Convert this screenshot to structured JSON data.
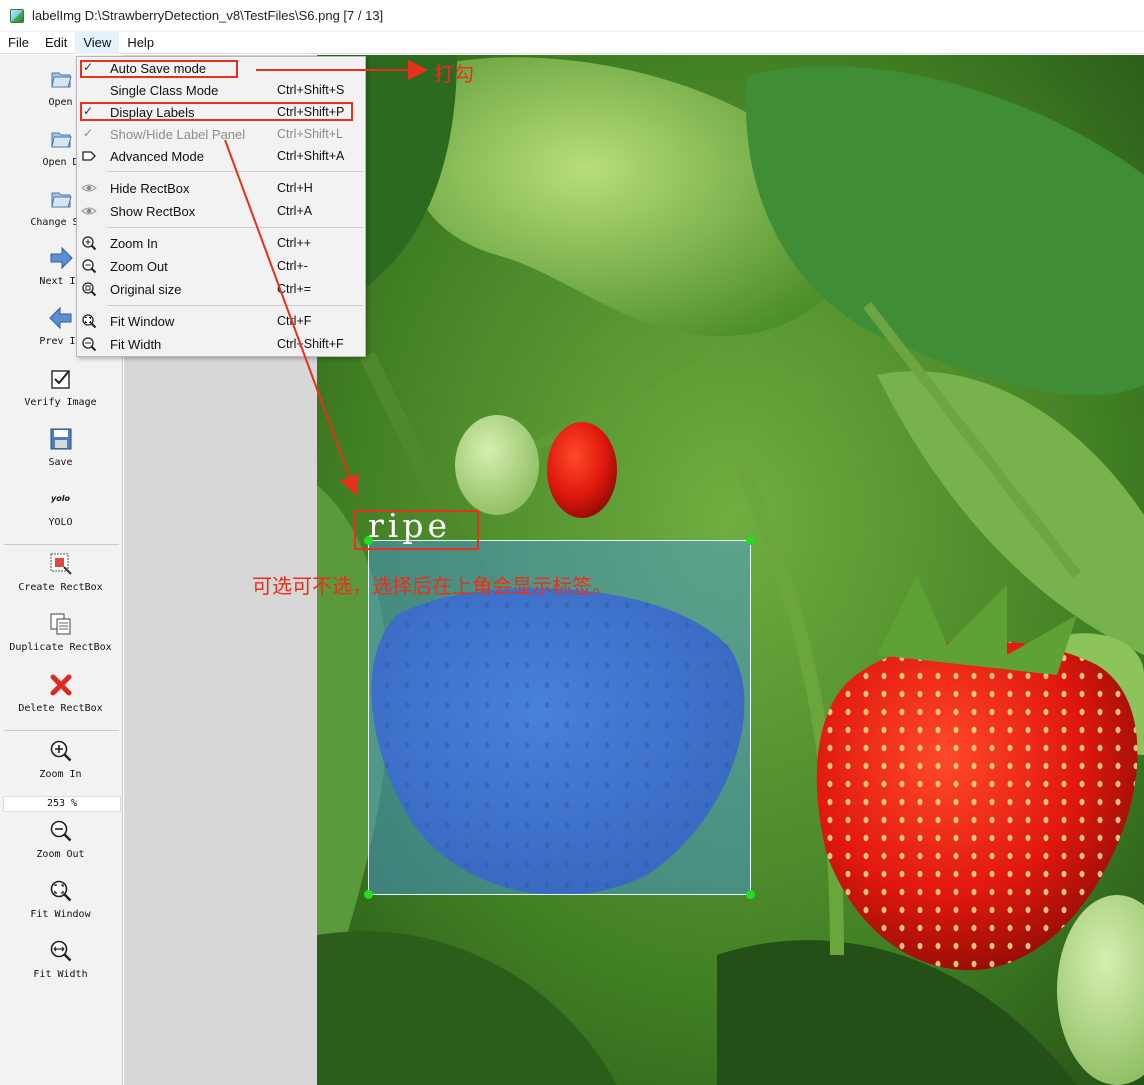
{
  "window": {
    "title": "labelImg D:\\StrawberryDetection_v8\\TestFiles\\S6.png [7 / 13]"
  },
  "menubar": {
    "items": [
      "File",
      "Edit",
      "View",
      "Help"
    ]
  },
  "toolbar": {
    "open": "Open",
    "open_dir": "Open D",
    "change_save": "Change Sav",
    "next_image": "Next Im",
    "prev_image": "Prev Im",
    "verify_image": "Verify Image",
    "save": "Save",
    "yolo_icon_text": "yolo",
    "yolo": "YOLO",
    "create_rectbox": "Create RectBox",
    "duplicate_rectbox": "Duplicate RectBox",
    "delete_rectbox": "Delete RectBox",
    "zoom_in": "Zoom In",
    "zoom_value": "253 %",
    "zoom_out": "Zoom Out",
    "fit_window": "Fit Window",
    "fit_width": "Fit Width"
  },
  "view_menu": {
    "items": [
      {
        "label": "Auto Save mode",
        "shortcut": "",
        "checked": true
      },
      {
        "label": "Single Class Mode",
        "shortcut": "Ctrl+Shift+S",
        "checked": false
      },
      {
        "label": "Display Labels",
        "shortcut": "Ctrl+Shift+P",
        "checked": true
      },
      {
        "label": "Show/Hide Label Panel",
        "shortcut": "Ctrl+Shift+L",
        "checked": true,
        "disabled": true
      },
      {
        "label": "Advanced Mode",
        "shortcut": "Ctrl+Shift+A",
        "checked": false
      },
      {
        "label": "Hide RectBox",
        "shortcut": "Ctrl+H"
      },
      {
        "label": "Show RectBox",
        "shortcut": "Ctrl+A"
      },
      {
        "label": "Zoom In",
        "shortcut": "Ctrl++"
      },
      {
        "label": "Zoom Out",
        "shortcut": "Ctrl+-"
      },
      {
        "label": "Original size",
        "shortcut": "Ctrl+="
      },
      {
        "label": "Fit Window",
        "shortcut": "Ctrl+F"
      },
      {
        "label": "Fit Width",
        "shortcut": "Ctrl+Shift+F"
      }
    ]
  },
  "canvas": {
    "box_label": "ripe"
  },
  "annotations": {
    "tick_note": "打勾",
    "label_note": "可选可不选，选择后在上角会显示标签。",
    "color": "#e8301c"
  }
}
